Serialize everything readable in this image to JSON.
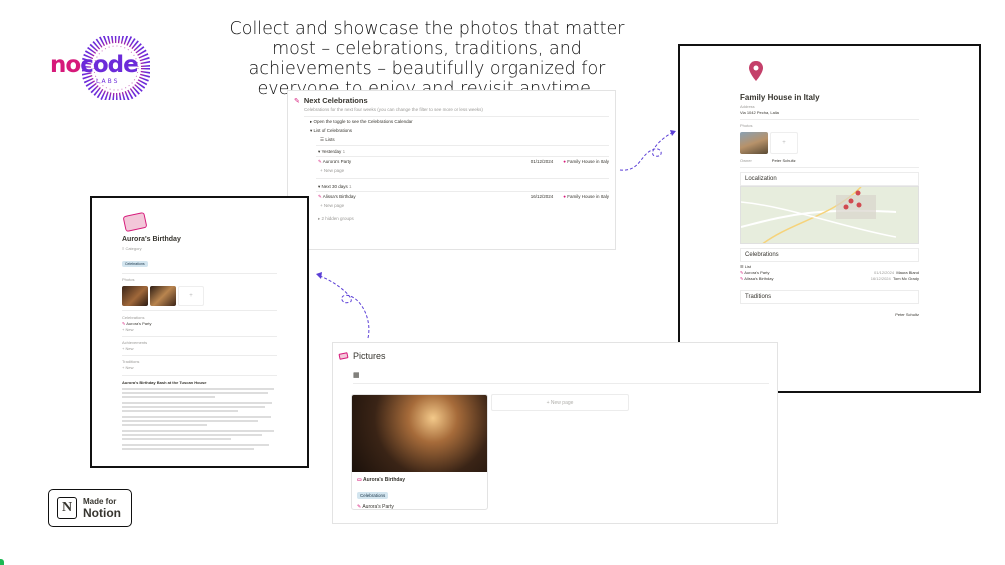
{
  "brand": {
    "logo_no": "no",
    "logo_code": "code",
    "logo_labs": "LABS",
    "pink": "#d6197a",
    "purple": "#6c2bd9"
  },
  "headline": "Collect and showcase the photos that matter most – celebrations, traditions, and achievements – beautifully organized for everyone to enjoy and revisit anytime.",
  "badge": {
    "line1": "Made for",
    "line2": "Notion",
    "icon": "notion-icon"
  },
  "celebrations_panel": {
    "title": "Next Celebrations",
    "description": "Celebrations for the next four weeks (you can change the filter to see more or less weeks)",
    "toggle_1": "Open the toggle to see the Celebrations Calendar",
    "toggle_2": "List of Celebrations",
    "view_label": "Lists",
    "groups": [
      {
        "label": "Yesterday",
        "count": "1",
        "items": [
          {
            "name": "Aurora's Party",
            "date": "01/12/2024",
            "place": "Family House in Italy"
          }
        ]
      },
      {
        "label": "Next 30 days",
        "count": "1",
        "items": [
          {
            "name": "Alissa's Birthday",
            "date": "16/12/2024",
            "place": "Family House in Italy"
          }
        ]
      }
    ],
    "new_page": "New page",
    "hidden_groups": "2 hidden groups"
  },
  "aurora_page": {
    "title": "Aurora's Birthday",
    "tag": "Celebrations",
    "photos_label": "Photos",
    "relation_label": "Celebrations",
    "relation_item": "Aurora's Party",
    "achievements_label": "Achievements",
    "traditions_label": "Traditions",
    "new_label": "New",
    "body_heading": "Aurora's Birthday Bash at the Tuscan House"
  },
  "family_page": {
    "title": "Family House in Italy",
    "address_label": "Address",
    "address_value": "Via 1042 Pecha, Lalia",
    "photos_label": "Photos",
    "owner_label": "Owner",
    "owner_value": "Peter Schultz",
    "localization_title": "Localization",
    "celebrations_title": "Celebrations",
    "celebrations_view": "List",
    "celebrations": [
      {
        "name": "Aurora's Party",
        "date": "01/12/2024",
        "person": "Maura Bland"
      },
      {
        "name": "Alissa's Birthday",
        "date": "16/12/2024",
        "person": "Tom Mc Grady"
      }
    ],
    "traditions_title": "Traditions",
    "traditions_person": "Peter Schultz"
  },
  "pictures_panel": {
    "title": "Pictures",
    "new_page": "New page",
    "card": {
      "title": "Aurora's Birthday",
      "tag": "Celebrations",
      "relation": "Aurora's Party"
    }
  },
  "colors": {
    "accent_pink": "#d6197a",
    "arrow_purple": "#5b3fd6",
    "tag_blue": "#d3e5ef"
  }
}
